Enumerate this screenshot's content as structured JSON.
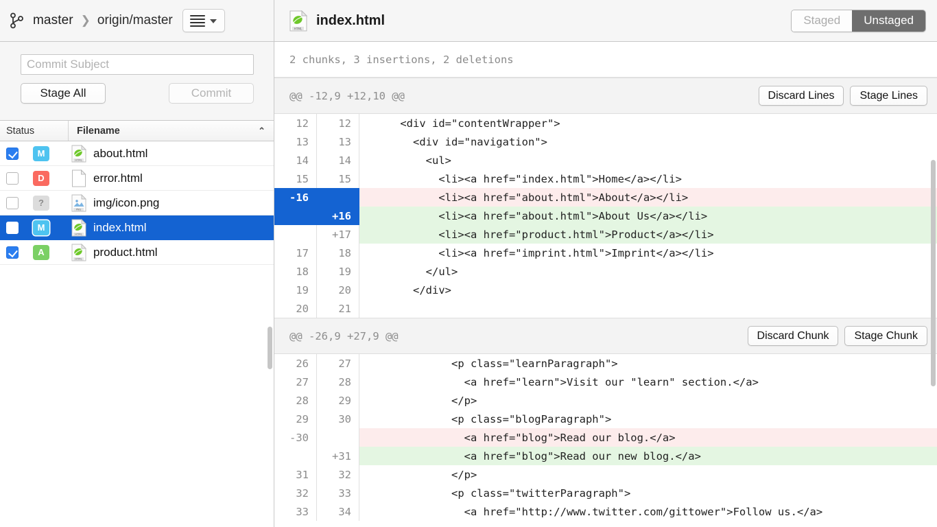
{
  "sidebar": {
    "branch_bar": {
      "branch_icon": "git-branch-icon",
      "local_branch": "master",
      "separator": "❯",
      "remote_branch": "origin/master",
      "menu_icon": "hamburger-icon",
      "chevron_icon": "chevron-down-icon"
    },
    "commit": {
      "subject_value": "",
      "subject_placeholder": "Commit Subject",
      "stage_all_label": "Stage All",
      "commit_label": "Commit",
      "commit_enabled": false
    },
    "list_header": {
      "status_label": "Status",
      "filename_label": "Filename",
      "sort_caret": "⌃"
    },
    "files": [
      {
        "checked": true,
        "status": "M",
        "status_kind": "modified",
        "icon": "html-file-icon",
        "name": "about.html",
        "selected": false
      },
      {
        "checked": false,
        "status": "D",
        "status_kind": "deleted",
        "icon": "blank-file-icon",
        "name": "error.html",
        "selected": false
      },
      {
        "checked": false,
        "status": "?",
        "status_kind": "untracked",
        "icon": "image-file-icon",
        "name": "img/icon.png",
        "selected": false
      },
      {
        "checked": false,
        "status": "M",
        "status_kind": "modified",
        "icon": "html-file-icon",
        "name": "index.html",
        "selected": true
      },
      {
        "checked": true,
        "status": "A",
        "status_kind": "added",
        "icon": "html-file-icon",
        "name": "product.html",
        "selected": false
      }
    ]
  },
  "right": {
    "file_bar": {
      "icon": "html-file-icon",
      "title": "index.html",
      "segmented": {
        "staged_label": "Staged",
        "unstaged_label": "Unstaged",
        "active": "Unstaged"
      }
    },
    "summary": "2 chunks, 3 insertions, 2 deletions",
    "chunks": [
      {
        "header": "@@ -12,9 +12,10 @@",
        "btn_left": "Discard Lines",
        "btn_right": "Stage Lines",
        "lines": [
          {
            "old": "12",
            "new": "12",
            "kind": "ctx",
            "old_sel": false,
            "new_sel": false,
            "text": "    <div id=\"contentWrapper\">"
          },
          {
            "old": "13",
            "new": "13",
            "kind": "ctx",
            "old_sel": false,
            "new_sel": false,
            "text": "      <div id=\"navigation\">"
          },
          {
            "old": "14",
            "new": "14",
            "kind": "ctx",
            "old_sel": false,
            "new_sel": false,
            "text": "        <ul>"
          },
          {
            "old": "15",
            "new": "15",
            "kind": "ctx",
            "old_sel": false,
            "new_sel": false,
            "text": "          <li><a href=\"index.html\">Home</a></li>"
          },
          {
            "old": "-16",
            "new": "",
            "kind": "del",
            "old_sel": true,
            "new_sel": true,
            "text": "          <li><a href=\"about.html\">About</a></li>"
          },
          {
            "old": "",
            "new": "+16",
            "kind": "add",
            "old_sel": true,
            "new_sel": true,
            "text": "          <li><a href=\"about.html\">About Us</a></li>"
          },
          {
            "old": "",
            "new": "+17",
            "kind": "add",
            "old_sel": false,
            "new_sel": false,
            "text": "          <li><a href=\"product.html\">Product</a></li>"
          },
          {
            "old": "17",
            "new": "18",
            "kind": "ctx",
            "old_sel": false,
            "new_sel": false,
            "text": "          <li><a href=\"imprint.html\">Imprint</a></li>"
          },
          {
            "old": "18",
            "new": "19",
            "kind": "ctx",
            "old_sel": false,
            "new_sel": false,
            "text": "        </ul>"
          },
          {
            "old": "19",
            "new": "20",
            "kind": "ctx",
            "old_sel": false,
            "new_sel": false,
            "text": "      </div>"
          },
          {
            "old": "20",
            "new": "21",
            "kind": "ctx",
            "old_sel": false,
            "new_sel": false,
            "text": ""
          }
        ]
      },
      {
        "header": "@@ -26,9 +27,9 @@",
        "btn_left": "Discard Chunk",
        "btn_right": "Stage Chunk",
        "lines": [
          {
            "old": "26",
            "new": "27",
            "kind": "ctx",
            "old_sel": false,
            "new_sel": false,
            "text": "            <p class=\"learnParagraph\">"
          },
          {
            "old": "27",
            "new": "28",
            "kind": "ctx",
            "old_sel": false,
            "new_sel": false,
            "text": "              <a href=\"learn\">Visit our \"learn\" section.</a>"
          },
          {
            "old": "28",
            "new": "29",
            "kind": "ctx",
            "old_sel": false,
            "new_sel": false,
            "text": "            </p>"
          },
          {
            "old": "29",
            "new": "30",
            "kind": "ctx",
            "old_sel": false,
            "new_sel": false,
            "text": "            <p class=\"blogParagraph\">"
          },
          {
            "old": "-30",
            "new": "",
            "kind": "del",
            "old_sel": false,
            "new_sel": false,
            "text": "              <a href=\"blog\">Read our blog.</a>"
          },
          {
            "old": "",
            "new": "+31",
            "kind": "add",
            "old_sel": false,
            "new_sel": false,
            "text": "              <a href=\"blog\">Read our new blog.</a>"
          },
          {
            "old": "31",
            "new": "32",
            "kind": "ctx",
            "old_sel": false,
            "new_sel": false,
            "text": "            </p>"
          },
          {
            "old": "32",
            "new": "33",
            "kind": "ctx",
            "old_sel": false,
            "new_sel": false,
            "text": "            <p class=\"twitterParagraph\">"
          },
          {
            "old": "33",
            "new": "34",
            "kind": "ctx",
            "old_sel": false,
            "new_sel": false,
            "text": "              <a href=\"http://www.twitter.com/gittower\">Follow us.</a>"
          }
        ]
      }
    ]
  },
  "colors": {
    "selection_blue": "#1463d2",
    "checkbox_blue": "#2b7ef0",
    "status_modified": "#4ec3f0",
    "status_deleted": "#fa6a60",
    "status_added": "#7bd065",
    "status_untracked": "#dcdcdc",
    "diff_added_bg": "#e4f6e2",
    "diff_deleted_bg": "#fdecec",
    "toolbar_bg": "#f6f6f6",
    "segment_active_bg": "#6e6e6e"
  }
}
